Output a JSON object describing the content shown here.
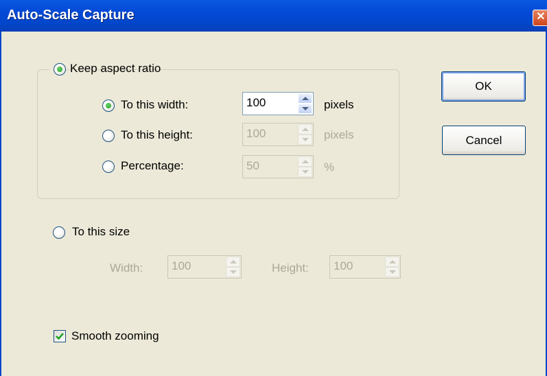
{
  "window": {
    "title": "Auto-Scale Capture",
    "close_glyph": "✕"
  },
  "keep_aspect": {
    "label": "Keep aspect ratio",
    "selected": true,
    "width": {
      "label": "To this width:",
      "value": "100",
      "unit": "pixels",
      "selected": true
    },
    "height": {
      "label": "To this height:",
      "value": "100",
      "unit": "pixels",
      "selected": false
    },
    "percentage": {
      "label": "Percentage:",
      "value": "50",
      "unit": "%",
      "selected": false
    }
  },
  "to_size": {
    "label": "To this size",
    "selected": false,
    "width_label": "Width:",
    "width_value": "100",
    "height_label": "Height:",
    "height_value": "100"
  },
  "smooth_zoom": {
    "label": "Smooth zooming",
    "checked": true
  },
  "buttons": {
    "ok": "OK",
    "cancel": "Cancel"
  },
  "colors": {
    "titlebar": "#0247cc",
    "face": "#ece9d8",
    "radio_dot": "#21a121"
  }
}
